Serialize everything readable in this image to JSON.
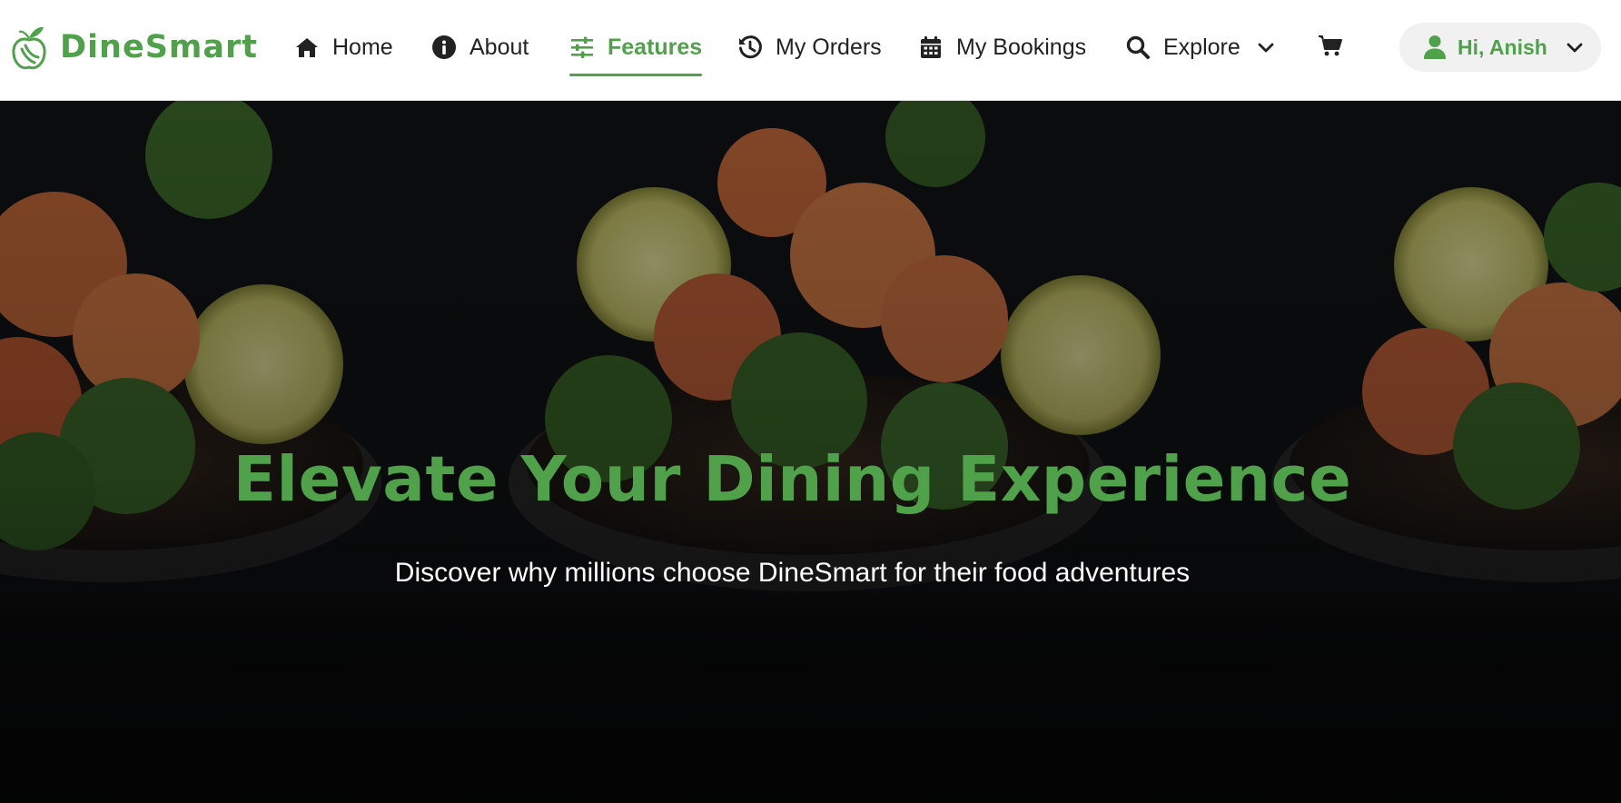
{
  "brand": {
    "name": "DineSmart",
    "color": "#4fa14a"
  },
  "nav": {
    "items": [
      {
        "label": "Home",
        "icon": "home-icon"
      },
      {
        "label": "About",
        "icon": "info-icon"
      },
      {
        "label": "Features",
        "icon": "sliders-icon",
        "active": true
      },
      {
        "label": "My Orders",
        "icon": "history-icon"
      },
      {
        "label": "My Bookings",
        "icon": "calendar-icon"
      },
      {
        "label": "Explore",
        "icon": "search-icon",
        "dropdown": true
      }
    ],
    "cart_icon": "cart-icon"
  },
  "user": {
    "greeting": "Hi, Anish",
    "icon": "user-icon"
  },
  "hero": {
    "title": "Elevate Your Dining Experience",
    "subtitle": "Discover why millions choose DineSmart for their food adventures"
  },
  "colors": {
    "accent": "#4fa14a",
    "nav_text": "#222222",
    "pill_bg": "#f1f1f1"
  }
}
